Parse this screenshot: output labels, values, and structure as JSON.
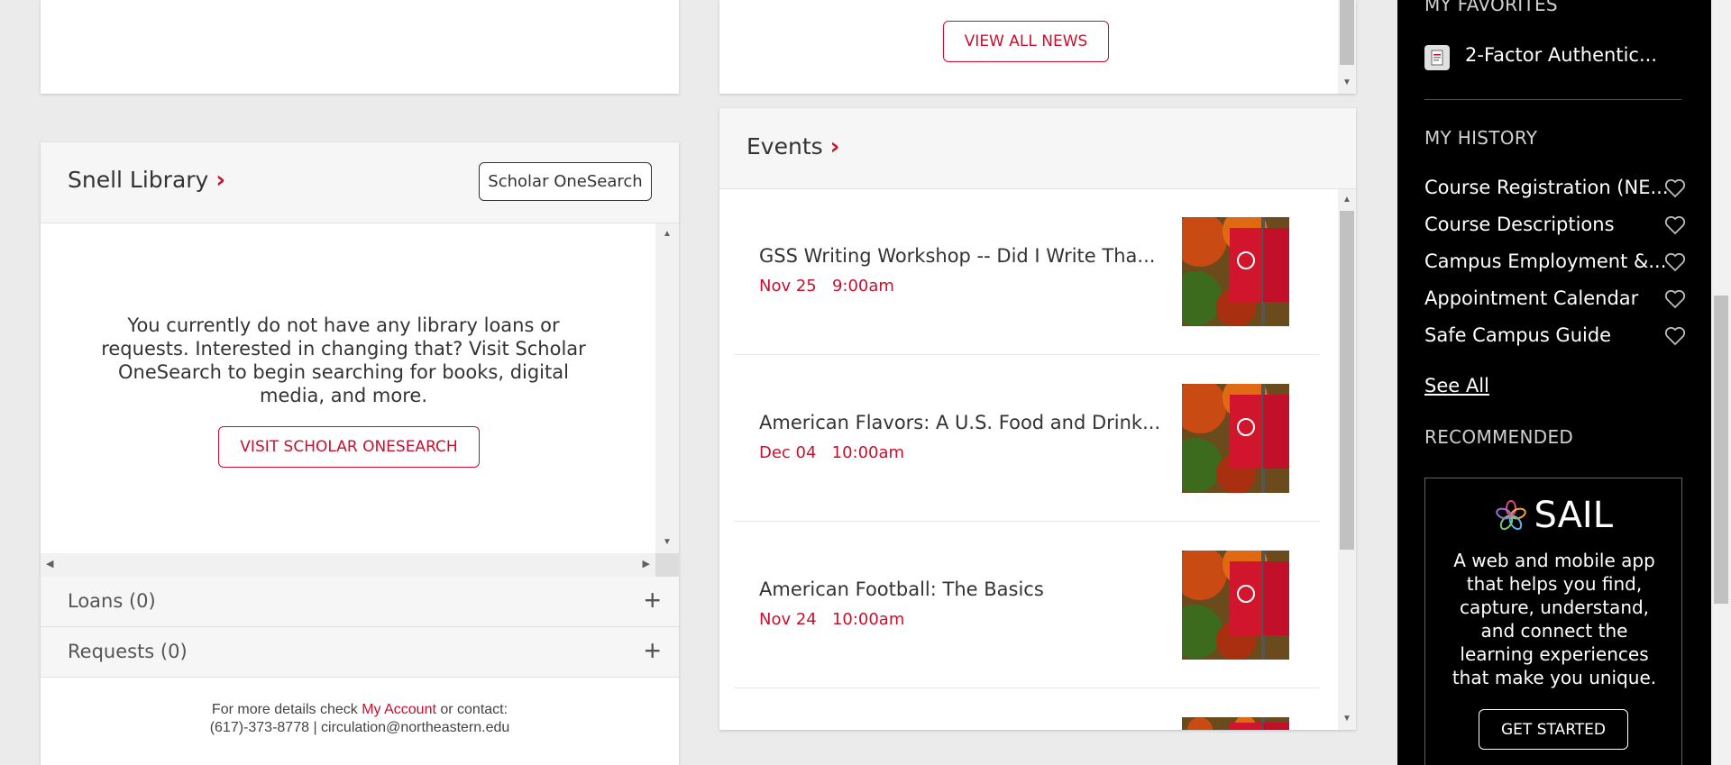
{
  "news": {
    "view_all_label": "VIEW ALL NEWS"
  },
  "library": {
    "title": "Snell Library",
    "onesearch_button": "Scholar OneSearch",
    "message": "You currently do not have any library loans or requests. Interested in changing that? Visit Scholar OneSearch to begin searching for books, digital media, and more.",
    "visit_button": "VISIT SCHOLAR ONESEARCH",
    "loans_label": "Loans (0)",
    "requests_label": "Requests (0)",
    "footer_prefix": "For more details check ",
    "footer_link": "My Account",
    "footer_suffix": " or contact:",
    "footer_contact": "(617)-373-8778 | circulation@northeastern.edu"
  },
  "events": {
    "title": "Events",
    "items": [
      {
        "title": "GSS Writing Workshop -- Did I Write Tha...",
        "date": "Nov 25",
        "time": "9:00am"
      },
      {
        "title": "American Flavors: A U.S. Food and Drink...",
        "date": "Dec 04",
        "time": "10:00am"
      },
      {
        "title": "American Football: The Basics",
        "date": "Nov 24",
        "time": "10:00am"
      }
    ]
  },
  "sidebar": {
    "favorites_label": "MY FAVORITES",
    "favorites": [
      {
        "label": "2-Factor Authentic..."
      }
    ],
    "history_label": "MY HISTORY",
    "history": [
      {
        "label": "Course Registration (NE..."
      },
      {
        "label": "Course Descriptions"
      },
      {
        "label": "Campus Employment &..."
      },
      {
        "label": "Appointment Calendar"
      },
      {
        "label": "Safe Campus Guide"
      }
    ],
    "see_all": "See All",
    "recommended_label": "RECOMMENDED",
    "sail": {
      "name": "SAIL",
      "description": "A web and mobile app that helps you find, capture, understand, and connect the learning experiences that make you unique.",
      "cta": "GET STARTED"
    }
  },
  "colors": {
    "brand_red": "#c8102e",
    "sidebar_bg": "#000000",
    "page_bg": "#ebebeb"
  }
}
